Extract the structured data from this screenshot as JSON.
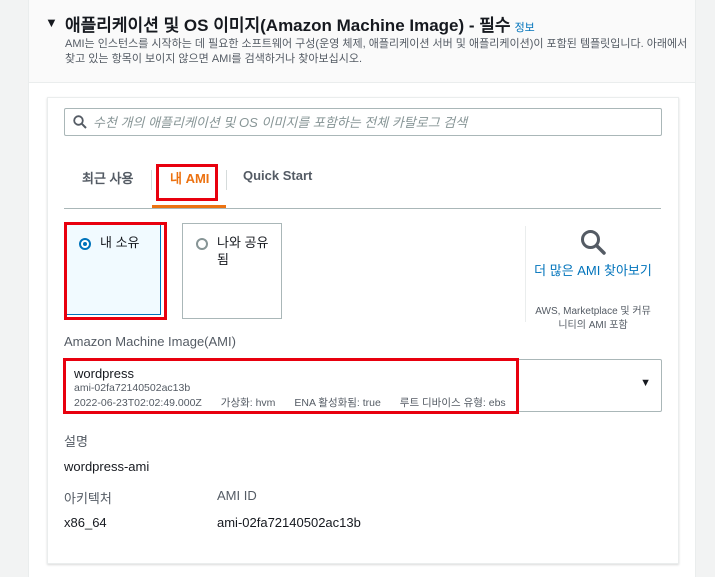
{
  "section": {
    "title": "애플리케이션 및 OS 이미지(Amazon Machine Image) - 필수",
    "info_link": "정보",
    "description": "AMI는 인스턴스를 시작하는 데 필요한 소프트웨어 구성(운영 체제, 애플리케이션 서버 및 애플리케이션)이 포함된 템플릿입니다. 아래에서 찾고 있는 항목이 보이지 않으면 AMI를 검색하거나 찾아보십시오."
  },
  "search": {
    "placeholder": "수천 개의 애플리케이션 및 OS 이미지를 포함하는 전체 카탈로그 검색",
    "value": ""
  },
  "tabs": [
    {
      "label": "최근 사용",
      "active": false
    },
    {
      "label": "내 AMI",
      "active": true
    },
    {
      "label": "Quick Start",
      "active": false
    }
  ],
  "ownership_options": [
    {
      "label": "내 소유",
      "selected": true
    },
    {
      "label": "나와 공유됨",
      "selected": false
    }
  ],
  "browse": {
    "link": "더 많은 AMI 찾아보기",
    "subtitle": "AWS, Marketplace 및 커뮤니티의 AMI 포함"
  },
  "ami_select": {
    "label": "Amazon Machine Image(AMI)",
    "name": "wordpress",
    "id": "ami-02fa72140502ac13b",
    "date": "2022-06-23T02:02:49.000Z",
    "virtualization": "가상화: hvm",
    "ena": "ENA 활성화됨: true",
    "root_device": "루트 디바이스 유형: ebs"
  },
  "details": {
    "description_label": "설명",
    "description_value": "wordpress-ami",
    "architecture_label": "아키텍처",
    "architecture_value": "x86_64",
    "ami_id_label": "AMI ID",
    "ami_id_value": "ami-02fa72140502ac13b"
  },
  "colors": {
    "accent": "#ec7211",
    "link": "#0073bb",
    "highlight": "#e8000e"
  }
}
